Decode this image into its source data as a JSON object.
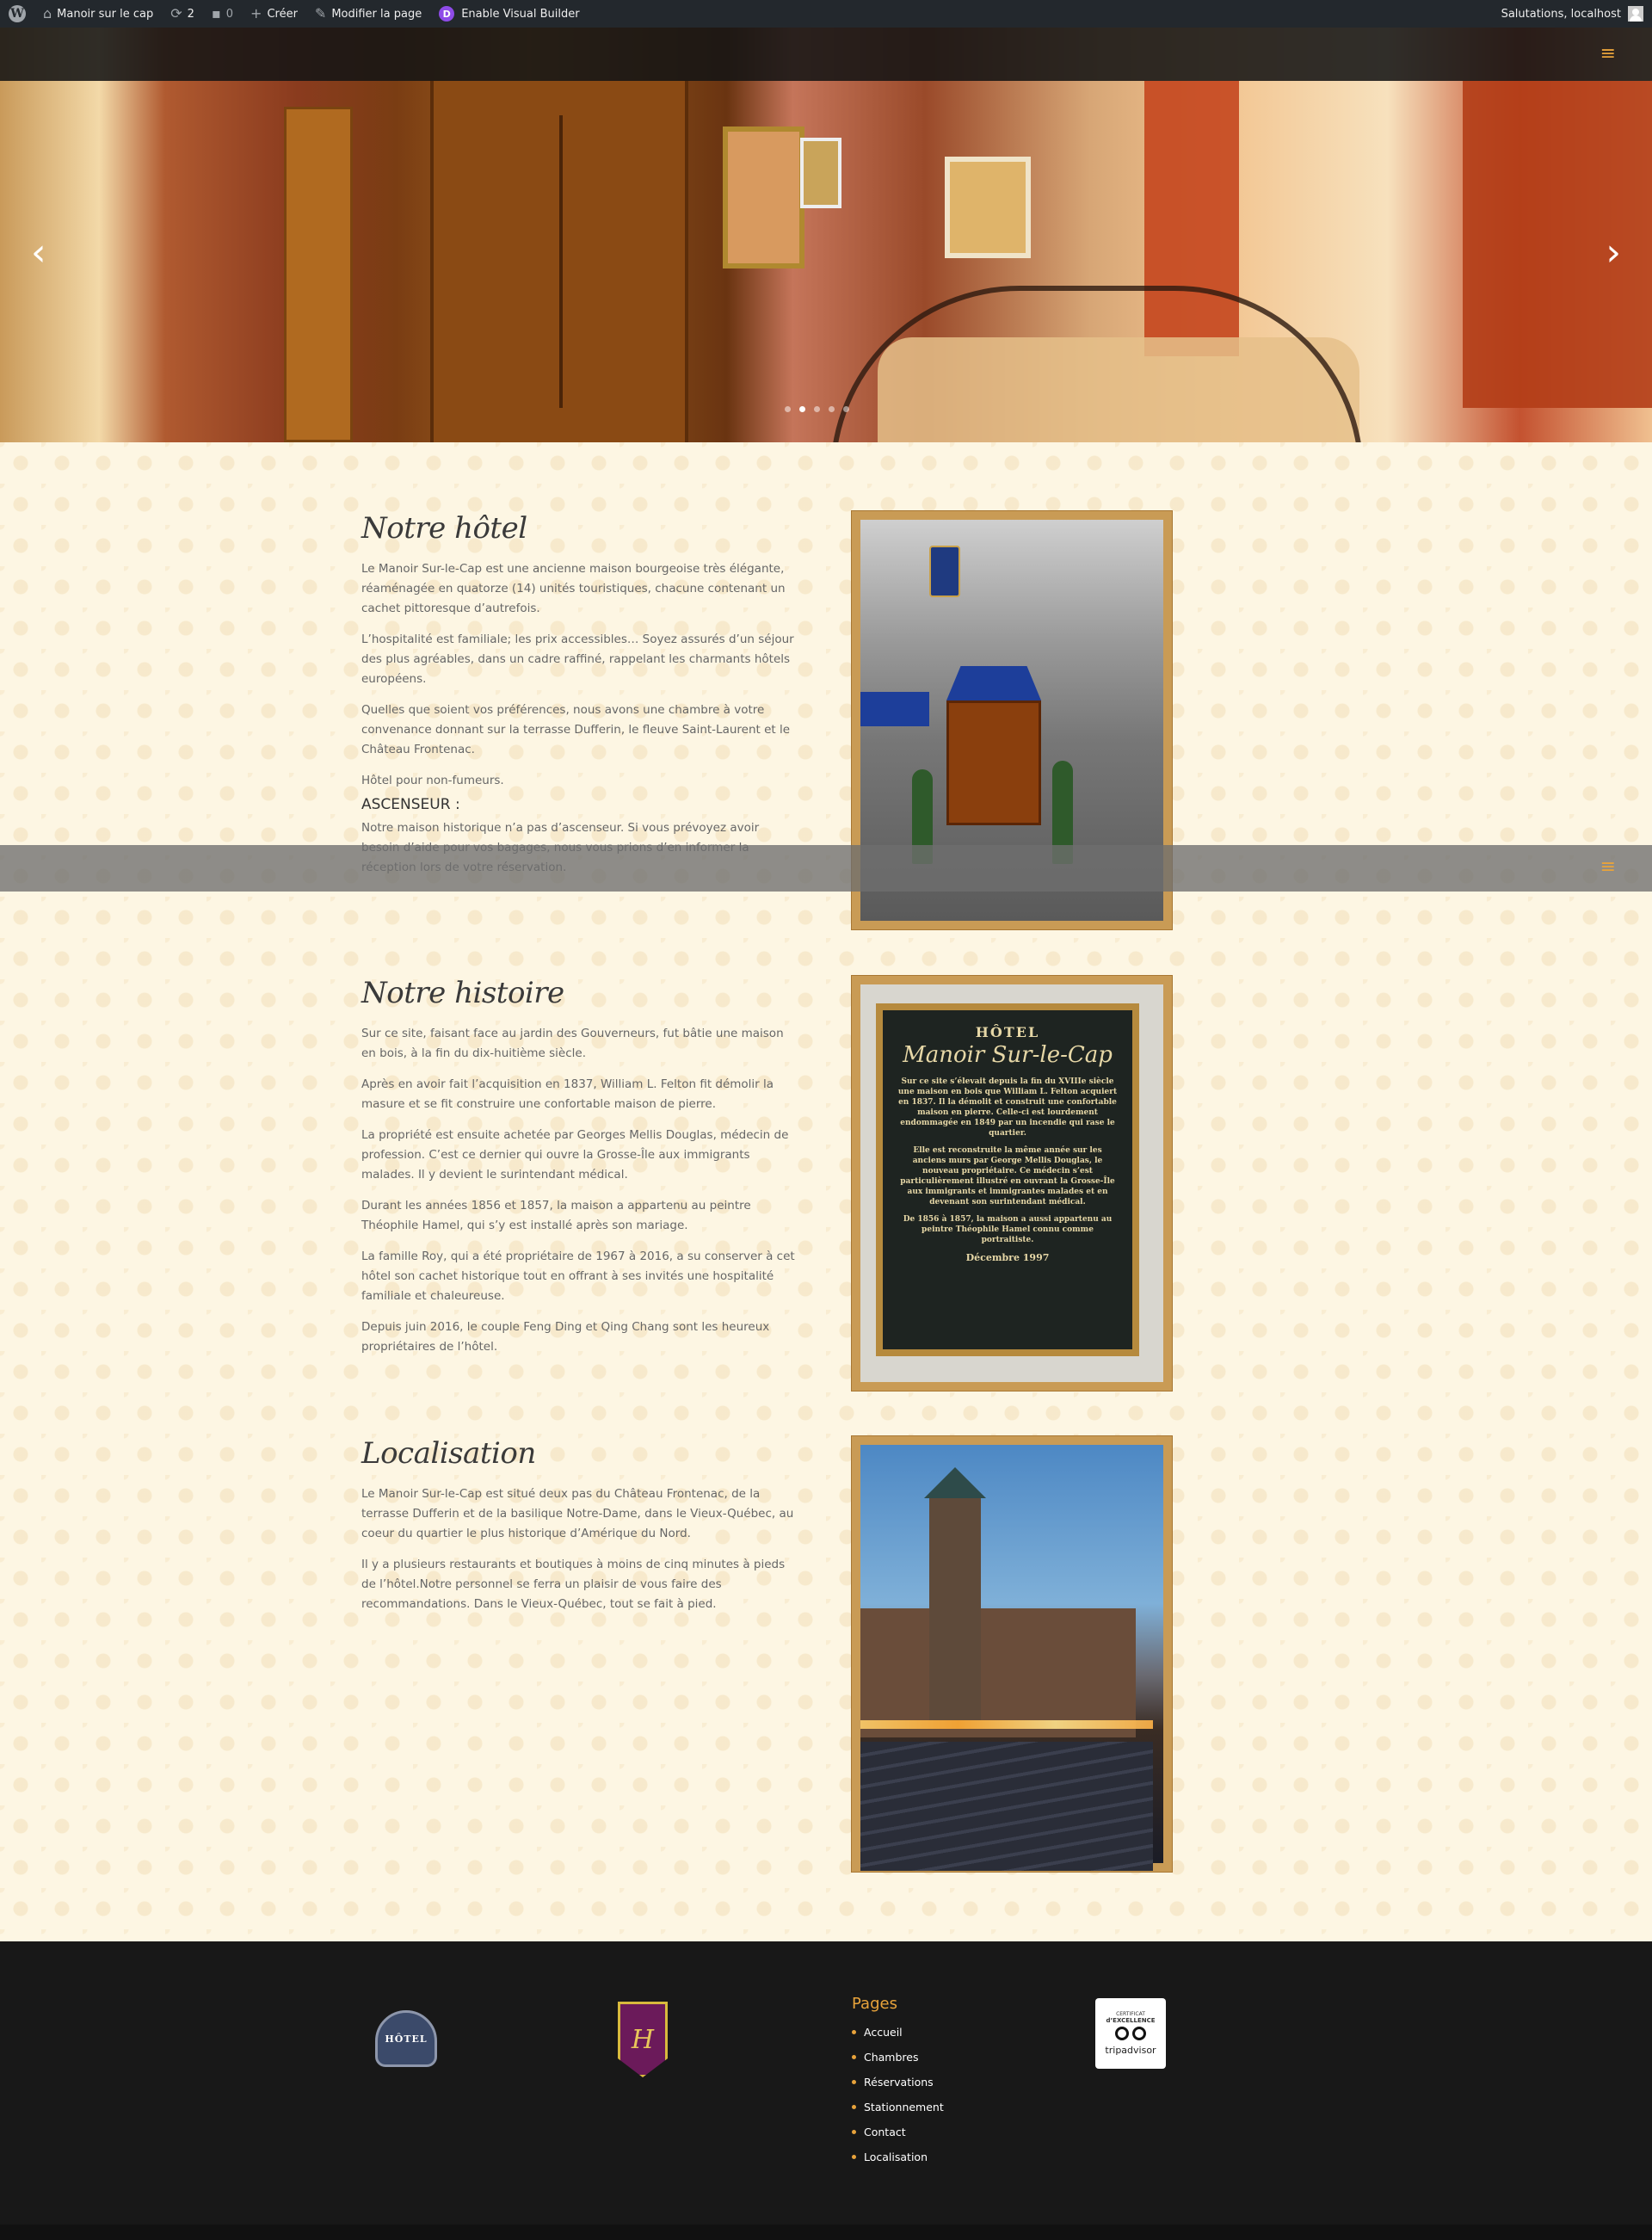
{
  "adminbar": {
    "site_name": "Manoir sur le cap",
    "updates_count": "2",
    "comments_count": "0",
    "create_label": "Créer",
    "edit_label": "Modifier la page",
    "visual_builder_label": "Enable Visual Builder",
    "greeting": "Salutations, localhost",
    "icons": [
      "wordpress-icon",
      "home-icon",
      "refresh-icon",
      "comment-icon",
      "plus-icon",
      "pencil-icon",
      "divi-icon",
      "avatar"
    ]
  },
  "slider": {
    "prev_arrow": "‹",
    "next_arrow": "›",
    "slide_count": 5,
    "active_slide": 2,
    "menu_icon": "≡"
  },
  "sections": {
    "hotel": {
      "title": "Notre hôtel",
      "paragraphs": [
        "Le Manoir Sur-le-Cap est une ancienne maison bourgeoise très élégante, réaménagée en quatorze (14) unités touristiques, chacune contenant un cachet pittoresque d’autrefois.",
        "L’hospitalité est familiale; les prix accessibles… Soyez assurés d’un séjour des plus agréables, dans un cadre raffiné, rappelant les charmants hôtels européens.",
        "Quelles que soient vos préférences, nous avons une chambre à votre convenance donnant sur la terrasse Dufferin, le fleuve Saint-Laurent et le Château Frontenac.",
        "Hôtel pour non-fumeurs."
      ],
      "subheading": "ASCENSEUR :",
      "elevator_text": "Notre maison historique n’a pas d’ascenseur. Si vous prévoyez avoir besoin d’aide pour vos bagages, nous vous prions d’en informer la réception lors de votre réservation."
    },
    "history": {
      "title": "Notre histoire",
      "paragraphs": [
        "Sur ce site, faisant face au jardin des Gouverneurs, fut bâtie une maison en bois, à la fin du dix-huitième siècle.",
        "Après en avoir fait l’acquisition en 1837, William L. Felton fit démolir la masure et se fit construire une confortable maison de pierre.",
        "La propriété est ensuite achetée par Georges Mellis Douglas, médecin de profession. C’est ce dernier qui ouvre la Grosse-Île aux immigrants malades. Il y devient le surintendant médical.",
        "Durant les années 1856 et 1857, la maison a appartenu au peintre Théophile Hamel, qui s’y est installé après son mariage.",
        "La famille Roy, qui a été propriétaire de 1967 à 2016, a su conserver à cet hôtel son cachet historique tout en offrant à ses invités une hospitalité familiale et chaleureuse.",
        "Depuis juin 2016, le couple Feng Ding et Qing Chang sont les heureux propriétaires de l’hôtel."
      ],
      "plaque": {
        "header": "HÔTEL",
        "name": "Manoir Sur-le-Cap",
        "p1": "Sur ce site s’élevait depuis la fin du XVIIIe siècle une maison en bois que William L. Felton acquiert en 1837. Il la démolit et construit une confortable maison en pierre. Celle-ci est lourdement endommagée en 1849 par un incendie qui rase le quartier.",
        "p2": "Elle est reconstruite la même année sur les anciens murs par George Mellis Douglas, le nouveau propriétaire. Ce médecin s’est particulièrement illustré en ouvrant la Grosse-Île aux immigrants et immigrantes malades et en devenant son surintendant médical.",
        "p3": "De 1856 à 1857, la maison a aussi appartenu au peintre Théophile Hamel connu comme portraitiste.",
        "date": "Décembre 1997"
      }
    },
    "location": {
      "title": "Localisation",
      "paragraphs": [
        "Le Manoir Sur-le-Cap est situé deux pas du Château Frontenac, de la terrasse Dufferin et de la basilique Notre-Dame, dans le Vieux-Québec, au coeur du quartier le plus historique d’Amérique du Nord.",
        "Il y a plusieurs restaurants et boutiques à moins de cinq minutes à pieds de l’hôtel.Notre personnel se ferra un plaisir de vous faire des recommandations. Dans le Vieux-Québec, tout se fait à pied."
      ]
    }
  },
  "footer": {
    "logo1_text": "HÔTEL",
    "logo2_text": "H",
    "pages_title": "Pages",
    "pages": [
      "Accueil",
      "Chambres",
      "Réservations",
      "Stationnement",
      "Contact",
      "Localisation"
    ],
    "tripadvisor": {
      "line1": "CERTIFICAT",
      "line2": "d’EXCELLENCE",
      "brand": "tripadvisor"
    }
  },
  "colors": {
    "accent": "#e8a33b",
    "adminbar": "#23282d",
    "footer": "#181818",
    "frame": "#c99b55"
  }
}
